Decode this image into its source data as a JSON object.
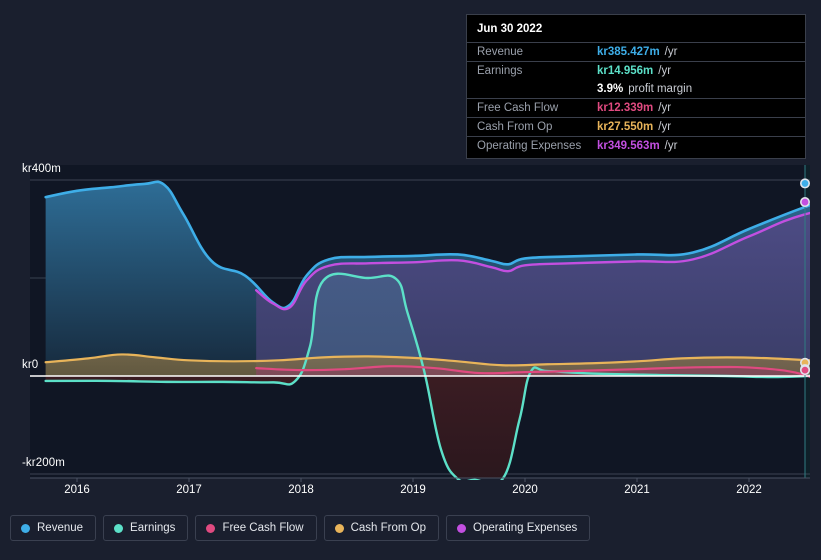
{
  "chart_data": {
    "type": "area",
    "title": "",
    "xlabel": "",
    "ylabel": "",
    "currency_prefix": "kr",
    "ylim": [
      -240,
      440
    ],
    "y_ticks": [
      "kr400m",
      "kr0",
      "-kr200m"
    ],
    "y_tick_values": [
      400,
      0,
      -200
    ],
    "grid": true,
    "x_ticks": [
      "2016",
      "2017",
      "2018",
      "2019",
      "2020",
      "2021",
      "2022"
    ],
    "x_tick_values": [
      2016,
      2017,
      2018,
      2019,
      2020,
      2021,
      2022
    ],
    "forecast_start": 2022.5,
    "legend_position": "bottom",
    "series": [
      {
        "name": "Revenue",
        "color": "#3eaee8",
        "x": [
          2015.72,
          2016.0,
          2016.3,
          2016.6,
          2016.78,
          2016.95,
          2017.2,
          2017.5,
          2017.75,
          2017.9,
          2018.05,
          2018.25,
          2018.6,
          2019.0,
          2019.4,
          2019.7,
          2019.85,
          2020.0,
          2020.4,
          2021.0,
          2021.5,
          2022.0,
          2022.5,
          2023.1
        ],
        "values": [
          365,
          378,
          385,
          392,
          390,
          330,
          235,
          205,
          150,
          145,
          205,
          238,
          243,
          245,
          248,
          235,
          228,
          240,
          244,
          248,
          252,
          300,
          345,
          393
        ]
      },
      {
        "name": "Operating Expenses",
        "color": "#c24fe0",
        "x": [
          2017.6,
          2017.75,
          2017.9,
          2018.05,
          2018.25,
          2018.6,
          2019.0,
          2019.4,
          2019.7,
          2019.85,
          2020.0,
          2020.4,
          2021.0,
          2021.5,
          2022.0,
          2022.5,
          2023.1
        ],
        "values": [
          175,
          148,
          140,
          195,
          225,
          230,
          232,
          236,
          222,
          214,
          226,
          230,
          234,
          238,
          285,
          330,
          355
        ]
      },
      {
        "name": "Earnings",
        "color": "#5ce0c8",
        "x": [
          2015.72,
          2016.3,
          2016.8,
          2017.3,
          2017.75,
          2017.95,
          2018.08,
          2018.2,
          2018.6,
          2018.85,
          2018.95,
          2019.1,
          2019.25,
          2019.4,
          2019.55,
          2019.8,
          2019.95,
          2020.05,
          2020.2,
          2020.6,
          2021.2,
          2021.8,
          2022.3,
          2022.8,
          2023.1
        ],
        "values": [
          -10,
          -10,
          -12,
          -12,
          -13,
          -10,
          60,
          195,
          200,
          198,
          130,
          10,
          -150,
          -210,
          -212,
          -210,
          -90,
          8,
          10,
          5,
          2,
          0,
          -2,
          5,
          14
        ]
      },
      {
        "name": "Cash From Op",
        "color": "#e8b45a",
        "x": [
          2015.72,
          2016.1,
          2016.4,
          2016.7,
          2017.0,
          2017.4,
          2017.8,
          2018.2,
          2018.6,
          2019.0,
          2019.4,
          2019.8,
          2020.2,
          2020.6,
          2021.0,
          2021.4,
          2021.8,
          2022.2,
          2022.7,
          2023.1
        ],
        "values": [
          28,
          36,
          44,
          38,
          32,
          30,
          32,
          38,
          40,
          37,
          30,
          22,
          24,
          26,
          30,
          36,
          38,
          36,
          30,
          27
        ]
      },
      {
        "name": "Free Cash Flow",
        "color": "#e04a80",
        "x": [
          2017.6,
          2018.0,
          2018.4,
          2018.8,
          2019.2,
          2019.6,
          2020.0,
          2020.4,
          2021.0,
          2021.6,
          2022.1,
          2022.5,
          2022.75,
          2022.95,
          2023.1
        ],
        "values": [
          16,
          12,
          14,
          20,
          16,
          6,
          8,
          10,
          14,
          18,
          16,
          2,
          -28,
          -16,
          12
        ]
      }
    ]
  },
  "tooltip": {
    "date": "Jun 30 2022",
    "rows": [
      {
        "name": "Revenue",
        "value": "kr385.427m",
        "unit": "/yr",
        "color": "#3eaee8"
      },
      {
        "name": "Earnings",
        "value": "kr14.956m",
        "unit": "/yr",
        "color": "#5ce0c8"
      },
      {
        "name": "",
        "value": "3.9%",
        "unit": "profit margin",
        "color": "#ffffff"
      },
      {
        "name": "Free Cash Flow",
        "value": "kr12.339m",
        "unit": "/yr",
        "color": "#e04a80"
      },
      {
        "name": "Cash From Op",
        "value": "kr27.550m",
        "unit": "/yr",
        "color": "#e8b45a"
      },
      {
        "name": "Operating Expenses",
        "value": "kr349.563m",
        "unit": "/yr",
        "color": "#c24fe0"
      }
    ]
  },
  "legend": {
    "items": [
      {
        "label": "Revenue",
        "color": "#3eaee8"
      },
      {
        "label": "Earnings",
        "color": "#5ce0c8"
      },
      {
        "label": "Free Cash Flow",
        "color": "#e04a80"
      },
      {
        "label": "Cash From Op",
        "color": "#e8b45a"
      },
      {
        "label": "Operating Expenses",
        "color": "#c24fe0"
      }
    ]
  }
}
